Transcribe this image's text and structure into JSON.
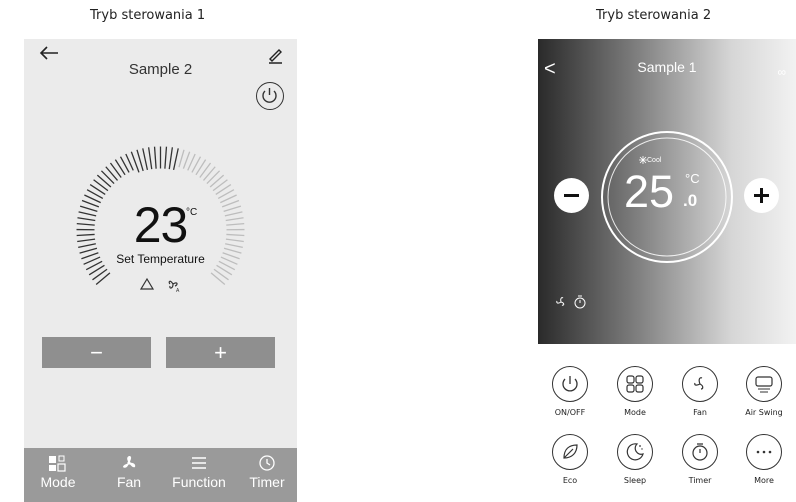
{
  "captions": {
    "left": "Tryb sterowania 1",
    "right": "Tryb sterowania 2"
  },
  "screen1": {
    "title": "Sample 2",
    "temperature": "23",
    "unit": "°C",
    "set_label": "Set Temperature",
    "minus_label": "−",
    "plus_label": "+",
    "tabs": [
      {
        "label": "Mode",
        "icon": "mode-icon"
      },
      {
        "label": "Fan",
        "icon": "fan-icon"
      },
      {
        "label": "Function",
        "icon": "menu-icon"
      },
      {
        "label": "Timer",
        "icon": "clock-icon"
      }
    ],
    "colors": {
      "background": "#ebebeb",
      "buttons": "#8f8f8f",
      "tab_bar": "#9a9a9a"
    }
  },
  "screen2": {
    "title": "Sample 1",
    "back": "<",
    "more": "∞",
    "mode": "Cool",
    "temperature": "25",
    "unit": "°C",
    "decimal": ".0",
    "buttons": [
      {
        "label": "ON/OFF",
        "icon": "power-icon"
      },
      {
        "label": "Mode",
        "icon": "mode-icon"
      },
      {
        "label": "Fan",
        "icon": "fan-icon"
      },
      {
        "label": "Air Swing",
        "icon": "air-swing-icon"
      },
      {
        "label": "Eco",
        "icon": "leaf-icon"
      },
      {
        "label": "Sleep",
        "icon": "moon-icon"
      },
      {
        "label": "Timer",
        "icon": "timer-icon"
      },
      {
        "label": "More",
        "icon": "more-icon"
      }
    ]
  }
}
